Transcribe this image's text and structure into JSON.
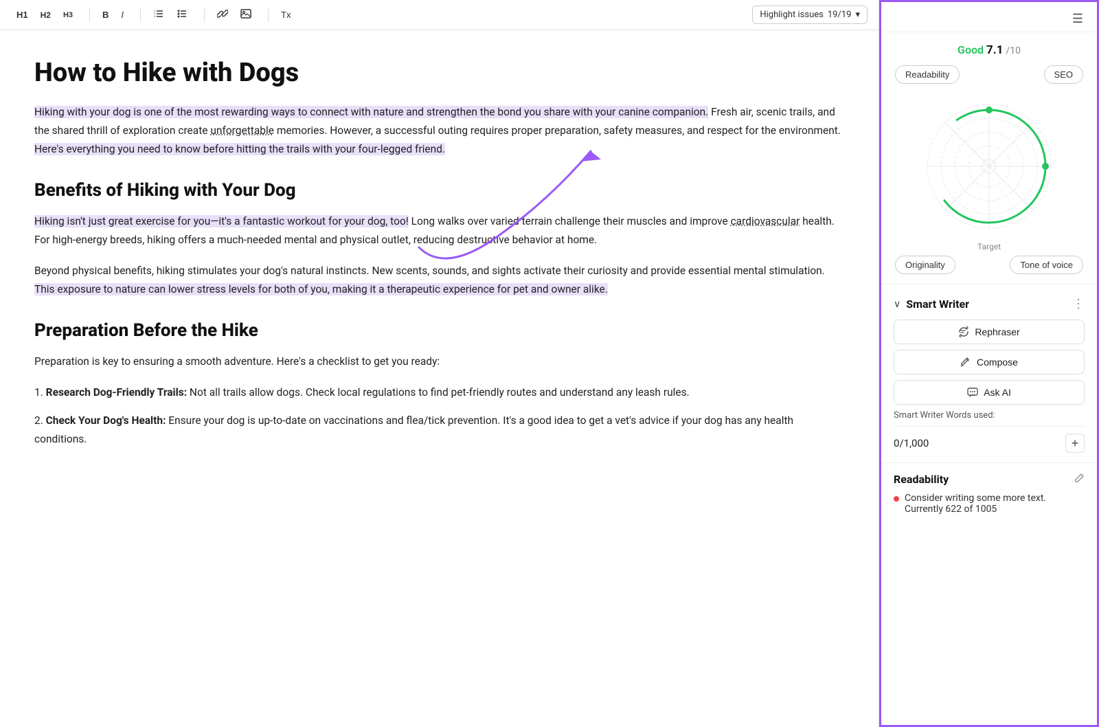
{
  "toolbar": {
    "h1_label": "H1",
    "h2_label": "H2",
    "h3_label": "H3",
    "bold_label": "B",
    "italic_label": "I",
    "ordered_list_icon": "≡",
    "unordered_list_icon": "☰",
    "link_icon": "🔗",
    "image_icon": "⊞",
    "clear_format_icon": "Tx",
    "highlight_label": "Highlight issues",
    "highlight_count": "19/19",
    "dropdown_arrow": "▾"
  },
  "editor": {
    "title": "How to Hike with Dogs",
    "paragraphs": [
      {
        "id": "p1",
        "parts": [
          {
            "text": "Hiking with your dog is one of the most rewarding ways to connect with nature and strengthen the bond you share with your canine companion.",
            "highlight": true
          },
          {
            "text": " Fresh air, scenic trails, and the shared thrill of exploration create ",
            "highlight": false
          },
          {
            "text": "unforgettable",
            "underline": true
          },
          {
            "text": " memories. However, a successful outing requires proper preparation, safety measures, and respect for the environment. ",
            "highlight": false
          },
          {
            "text": "Here's everything you need to know before hitting the trails with your four-legged friend.",
            "highlight": true
          }
        ]
      }
    ],
    "section1_title": "Benefits of Hiking with Your Dog",
    "section1_p1_parts": [
      {
        "text": "Hiking isn't just great exercise for you—it's a fantastic workout for your dog, too!",
        "highlight": true
      },
      {
        "text": " Long walks over varied terrain challenge their muscles and improve ",
        "highlight": false
      },
      {
        "text": "cardiovascular",
        "underline": true
      },
      {
        "text": " health. For high-energy breeds, hiking offers a much-needed mental and physical outlet, reducing destructive behavior at home.",
        "highlight": false
      }
    ],
    "section1_p2_parts": [
      {
        "text": "Beyond physical benefits, hiking stimulates your dog's natural instincts. New scents, sounds, and sights activate their curiosity and provide essential mental stimulation. ",
        "highlight": false
      },
      {
        "text": "This exposure to nature can lower stress levels for both of you, making it a therapeutic experience for pet and owner alike.",
        "highlight": true
      }
    ],
    "section2_title": "Preparation Before the Hike",
    "section2_intro": "Preparation is key to ensuring a smooth adventure. Here's a checklist to get you ready:",
    "section2_items": [
      {
        "num": "1.",
        "title": "Research Dog-Friendly Trails:",
        "text": " Not all trails allow dogs. Check local regulations to find pet-friendly routes and understand any leash rules."
      },
      {
        "num": "2.",
        "title": "Check Your Dog's Health:",
        "text": " Ensure your dog is up-to-date on vaccinations and flea/tick prevention. It's a good idea to get a vet's advice if your dog has any health conditions."
      }
    ]
  },
  "sidebar": {
    "menu_icon": "☰",
    "score_label_good": "Good",
    "score_value": "7.1",
    "score_denom": "/10",
    "tabs": [
      {
        "id": "readability",
        "label": "Readability"
      },
      {
        "id": "seo",
        "label": "SEO"
      }
    ],
    "chart_target_label": "Target",
    "bottom_tabs": [
      {
        "id": "originality",
        "label": "Originality"
      },
      {
        "id": "tone",
        "label": "Tone of voice"
      }
    ],
    "smart_writer": {
      "title": "Smart Writer",
      "chevron": "∨",
      "menu_icon": "⋮",
      "buttons": [
        {
          "id": "rephraser",
          "icon": "✏",
          "label": "Rephraser"
        },
        {
          "id": "compose",
          "icon": "✒",
          "label": "Compose"
        },
        {
          "id": "ask_ai",
          "icon": "💬",
          "label": "Ask AI"
        }
      ],
      "words_used_label": "Smart Writer Words used:",
      "words_count": "0",
      "words_max": "1,000",
      "plus_icon": "+"
    },
    "readability_section": {
      "title": "Readability",
      "edit_icon": "✏",
      "items": [
        {
          "text": "Consider writing some more text. Currently 622 of 1005"
        }
      ]
    }
  }
}
